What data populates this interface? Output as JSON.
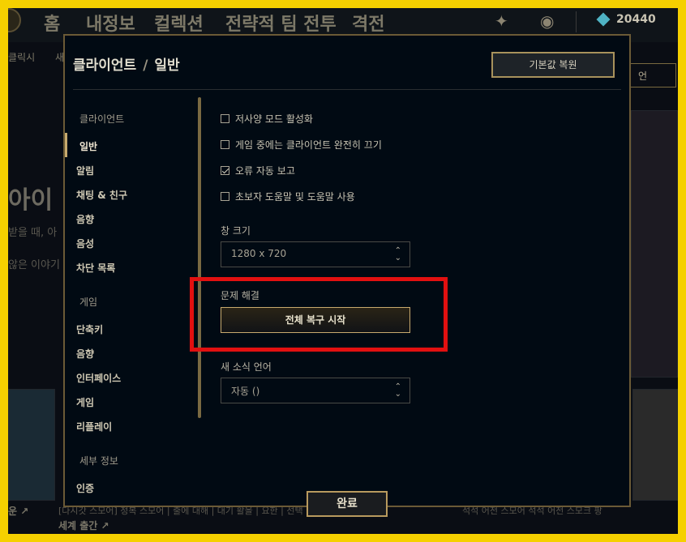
{
  "background": {
    "nav_items": [
      "홈",
      "내정보",
      "컬렉션",
      "전략적 팀 전투",
      "격전"
    ],
    "currency": "20440",
    "sub_items": [
      "클릭시",
      "새"
    ],
    "side_button": "언",
    "hero_title": "아이",
    "hero_lines": [
      "받을 때, 아",
      "않은 이야기"
    ],
    "footer_left": "운 ↗",
    "footer_lines": [
      "[다시갓 스모어] 정복 스모어 | 출에 대해 | 대기 활을 | 요한 | 선택 진표 안내 ↗",
      "세계 출간 ↗"
    ],
    "footer_right": "석석 어전 스모어 석석 어전 스모크 팡"
  },
  "modal": {
    "breadcrumb_parent": "클라이언트",
    "breadcrumb_sep": "/",
    "breadcrumb_current": "일반",
    "restore_label": "기본값 복원",
    "done_label": "완료"
  },
  "sidebar": {
    "client_category": "클라이언트",
    "client_items": [
      {
        "label": "일반",
        "active": true
      },
      {
        "label": "알림"
      },
      {
        "label": "채팅 & 친구"
      },
      {
        "label": "음향"
      },
      {
        "label": "음성"
      },
      {
        "label": "차단 목록"
      }
    ],
    "game_category": "게임",
    "game_items": [
      {
        "label": "단축키"
      },
      {
        "label": "음향"
      },
      {
        "label": "인터페이스"
      },
      {
        "label": "게임"
      },
      {
        "label": "리플레이"
      }
    ],
    "info_category": "세부 정보",
    "info_items": [
      {
        "label": "인증"
      }
    ]
  },
  "settings": {
    "checkboxes": [
      {
        "label": "저사양 모드 활성화",
        "checked": false
      },
      {
        "label": "게임 중에는 클라이언트 완전히 끄기",
        "checked": false
      },
      {
        "label": "오류 자동 보고",
        "checked": true
      },
      {
        "label": "초보자 도움말 및 도움말 사용",
        "checked": false
      }
    ],
    "window_size_label": "창 크기",
    "window_size_value": "1280 x 720",
    "troubleshoot_label": "문제 해결",
    "full_repair_label": "전체 복구 시작",
    "news_language_label": "새 소식 언어",
    "news_language_value": "자동 ()"
  },
  "colors": {
    "gold": "#c8aa6e",
    "highlight_red": "#e21010",
    "frame_yellow": "#f5d000"
  }
}
